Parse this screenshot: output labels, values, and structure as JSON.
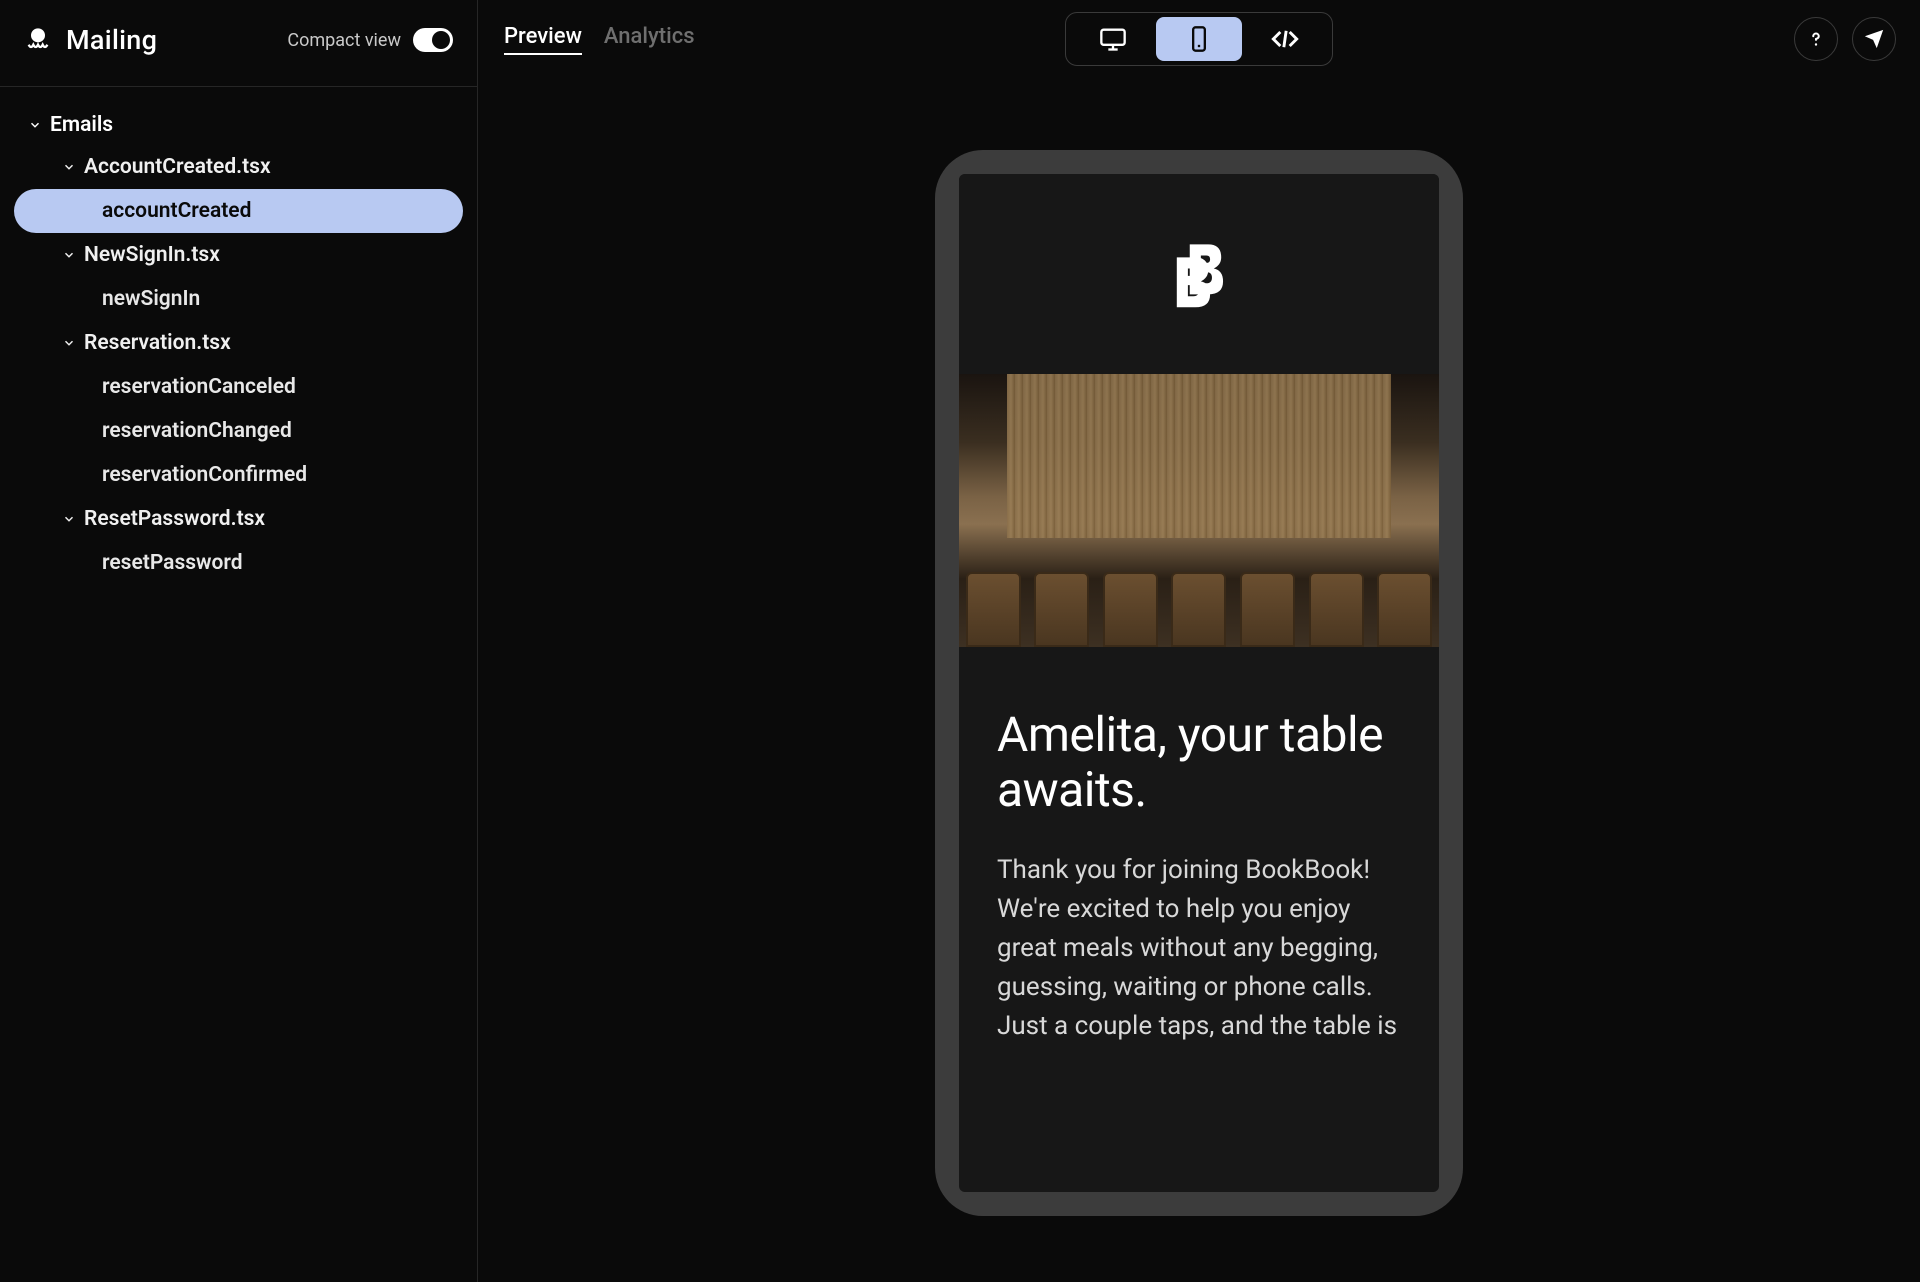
{
  "brand": {
    "name": "Mailing"
  },
  "sidebar": {
    "compact_label": "Compact view",
    "root_label": "Emails",
    "files": [
      {
        "name": "AccountCreated.tsx",
        "items": [
          {
            "label": "accountCreated",
            "active": true
          }
        ]
      },
      {
        "name": "NewSignIn.tsx",
        "items": [
          {
            "label": "newSignIn",
            "active": false
          }
        ]
      },
      {
        "name": "Reservation.tsx",
        "items": [
          {
            "label": "reservationCanceled",
            "active": false
          },
          {
            "label": "reservationChanged",
            "active": false
          },
          {
            "label": "reservationConfirmed",
            "active": false
          }
        ]
      },
      {
        "name": "ResetPassword.tsx",
        "items": [
          {
            "label": "resetPassword",
            "active": false
          }
        ]
      }
    ]
  },
  "topbar": {
    "tabs": [
      {
        "label": "Preview",
        "active": true
      },
      {
        "label": "Analytics",
        "active": false
      }
    ],
    "views": {
      "desktop": false,
      "mobile": true,
      "code": false
    }
  },
  "email": {
    "heading": "Amelita, your table awaits.",
    "body": "Thank you for joining BookBook! We're excited to help you enjoy great meals without any begging, guessing, waiting or phone calls. Just a couple taps, and the table is"
  }
}
